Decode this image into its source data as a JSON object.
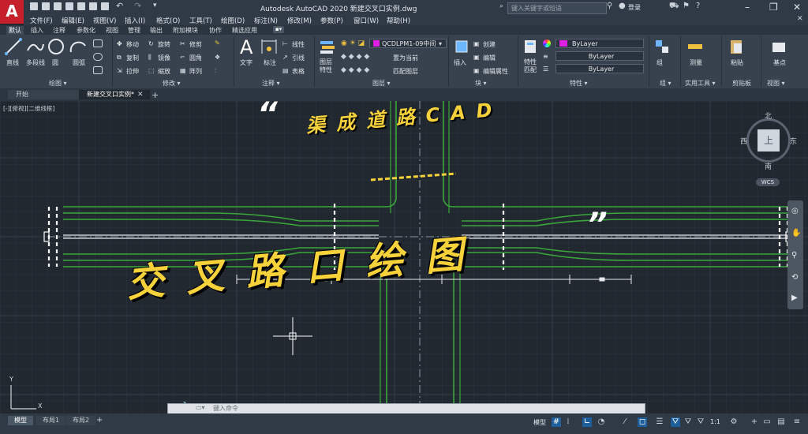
{
  "window": {
    "app_button": "A",
    "title": "Autodesk AutoCAD 2020    新建交叉口实例.dwg",
    "search_placeholder": "键入关键字或短语",
    "signin": "登录"
  },
  "menu": [
    "文件(F)",
    "编辑(E)",
    "视图(V)",
    "插入(I)",
    "格式(O)",
    "工具(T)",
    "绘图(D)",
    "标注(N)",
    "修改(M)",
    "参数(P)",
    "窗口(W)",
    "帮助(H)"
  ],
  "ribbon_tabs": [
    "默认",
    "插入",
    "注释",
    "参数化",
    "视图",
    "管理",
    "输出",
    "附加模块",
    "协作",
    "精选应用"
  ],
  "ribbon": {
    "draw": {
      "label": "绘图 ▾",
      "line": "直线",
      "polyline": "多段线",
      "circle": "圆",
      "arc": "圆弧"
    },
    "modify": {
      "label": "修改 ▾",
      "move": "移动",
      "rotate": "旋转",
      "trim": "修剪",
      "copy": "复制",
      "mirror": "镜像",
      "fillet": "圆角",
      "stretch": "拉伸",
      "scale": "缩放",
      "array": "阵列"
    },
    "annotation": {
      "label": "注释 ▾",
      "text": "文字",
      "dim": "标注",
      "linear": "线性",
      "leader": "引线",
      "table": "表格"
    },
    "layers": {
      "label": "图层 ▾",
      "props": "图层特性",
      "current_layer": "QCDLPM1-09中间",
      "make_current": "置为当前",
      "match": "匹配图层"
    },
    "block": {
      "label": "块 ▾",
      "insert": "插入",
      "create": "创建",
      "edit": "编辑",
      "attr": "编辑属性"
    },
    "properties": {
      "label": "特性 ▾",
      "match": "特性匹配",
      "color": "ByLayer",
      "linetype": "ByLayer",
      "lineweight": "ByLayer"
    },
    "group": {
      "label": "组 ▾",
      "group": "组"
    },
    "utilities": {
      "label": "实用工具 ▾",
      "measure": "测量"
    },
    "clipboard": {
      "label": "剪贴板",
      "paste": "粘贴"
    },
    "view": {
      "label": "视图 ▾",
      "base": "基点"
    }
  },
  "doc_tabs": [
    "开始",
    "新建交叉口实例*"
  ],
  "viewport_label": "[-][俯视][二维线框]",
  "overlay": {
    "subtitle": "渠成道路CAD",
    "headline": "交叉路口绘图",
    "open_quote": "“",
    "close_quote": "”"
  },
  "viewcube": {
    "north": "北",
    "south": "南",
    "east": "东",
    "west": "西",
    "top": "上",
    "wcs": "WCS"
  },
  "ucs": {
    "x": "X",
    "y": "Y"
  },
  "command_placeholder": "键入命令",
  "layout_tabs": [
    "模型",
    "布局1",
    "布局2"
  ],
  "status": {
    "model": "模型",
    "scale": "1:1"
  },
  "colors": {
    "road_line": "#3ba63b",
    "accent_yellow": "#f7d23a",
    "app_red": "#c5202b",
    "layer_swatch": "#e020e0"
  }
}
